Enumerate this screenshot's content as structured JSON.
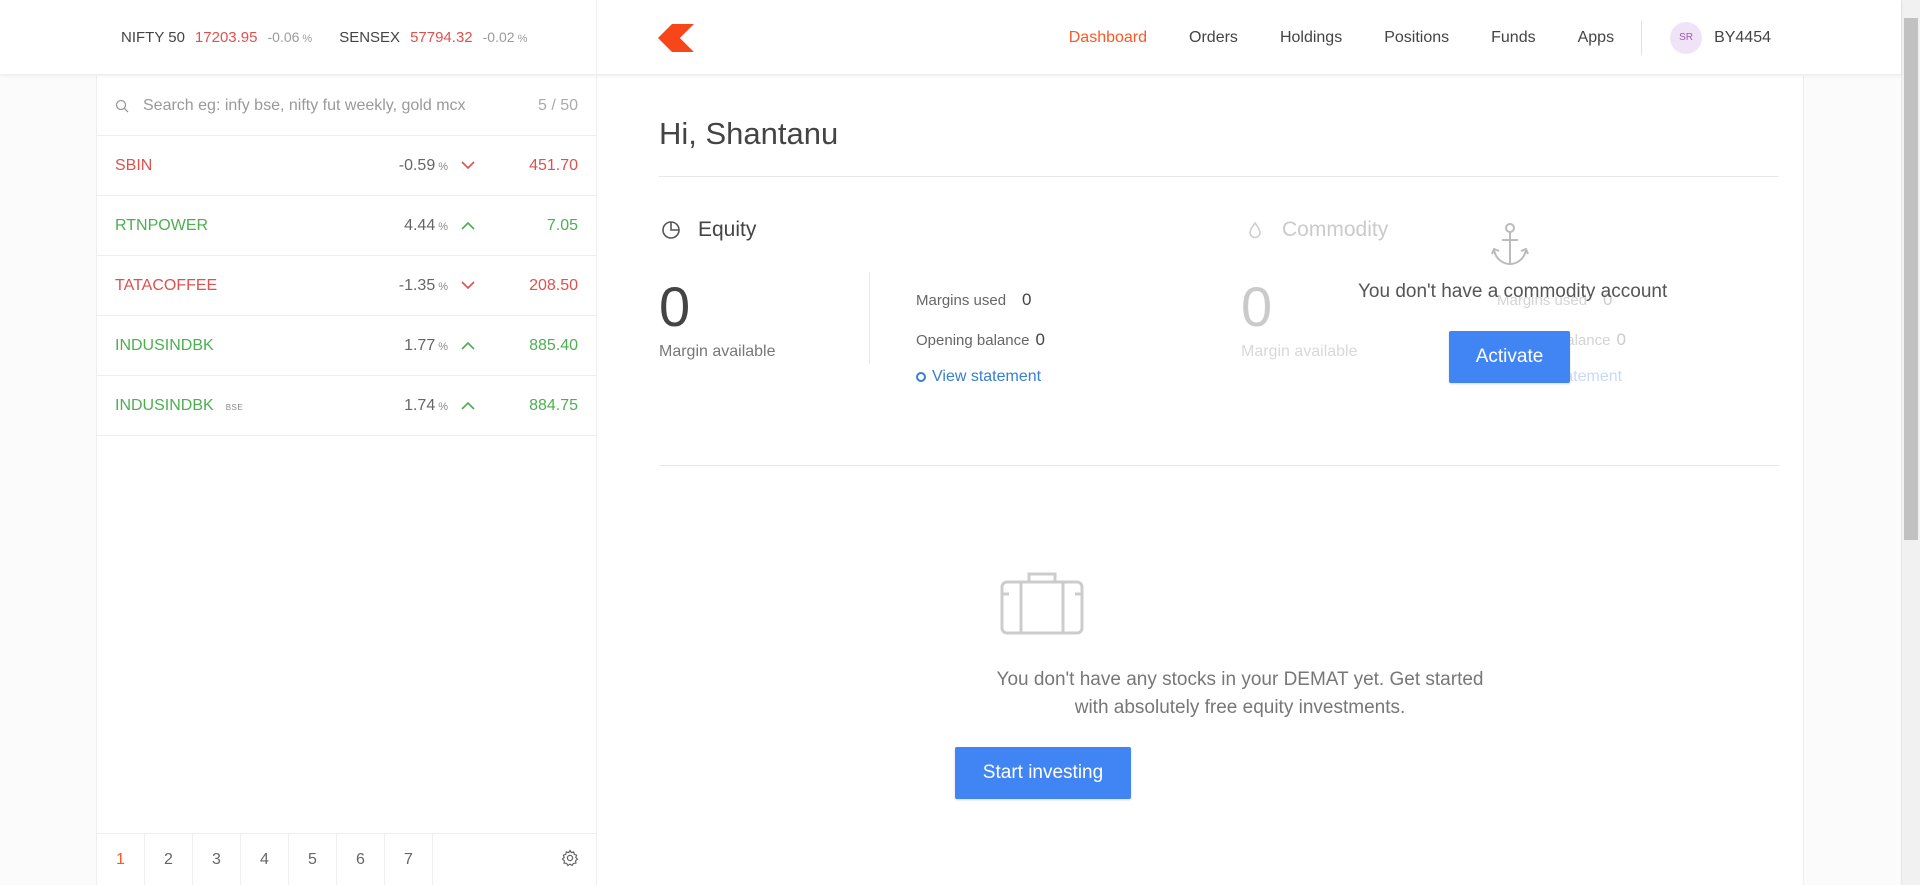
{
  "indices": [
    {
      "name": "NIFTY 50",
      "value": "17203.95",
      "change": "-0.06",
      "pct": "%"
    },
    {
      "name": "SENSEX",
      "value": "57794.32",
      "change": "-0.02",
      "pct": "%"
    }
  ],
  "nav": {
    "items": [
      "Dashboard",
      "Orders",
      "Holdings",
      "Positions",
      "Funds",
      "Apps"
    ],
    "active": "Dashboard",
    "avatar_initials": "SR",
    "user_id": "BY4454"
  },
  "search": {
    "placeholder": "Search eg: infy bse, nifty fut weekly, gold mcx",
    "count": "5 / 50"
  },
  "watchlist": [
    {
      "symbol": "SBIN",
      "exchange": "",
      "change": "-0.59",
      "pct": "%",
      "price": "451.70",
      "direction": "down"
    },
    {
      "symbol": "RTNPOWER",
      "exchange": "",
      "change": "4.44",
      "pct": "%",
      "price": "7.05",
      "direction": "up"
    },
    {
      "symbol": "TATACOFFEE",
      "exchange": "",
      "change": "-1.35",
      "pct": "%",
      "price": "208.50",
      "direction": "down"
    },
    {
      "symbol": "INDUSINDBK",
      "exchange": "",
      "change": "1.77",
      "pct": "%",
      "price": "885.40",
      "direction": "up"
    },
    {
      "symbol": "INDUSINDBK",
      "exchange": "BSE",
      "change": "1.74",
      "pct": "%",
      "price": "884.75",
      "direction": "up"
    }
  ],
  "pages": [
    "1",
    "2",
    "3",
    "4",
    "5",
    "6",
    "7"
  ],
  "active_page": "1",
  "greeting": "Hi, Shantanu",
  "equity": {
    "title": "Equity",
    "margin_available": "0",
    "margin_available_label": "Margin available",
    "margins_used_label": "Margins used",
    "margins_used": "0",
    "opening_balance_label": "Opening balance",
    "opening_balance": "0",
    "view_statement": "View statement"
  },
  "commodity": {
    "title": "Commodity",
    "margin_available": "0",
    "margin_available_label": "Margin available",
    "margins_used_label": "Margins used",
    "margins_used": "0",
    "opening_balance_label": "Opening balance",
    "opening_balance": "0",
    "view_statement": "View statement",
    "no_account_text": "You don't have a commodity account",
    "activate_label": "Activate"
  },
  "holdings_empty": {
    "line1": "You don't have any stocks in your DEMAT yet. Get started",
    "line2": "with absolutely free equity investments.",
    "button_label": "Start investing"
  },
  "colors": {
    "accent": "#ff5722",
    "down": "#df514c",
    "up": "#4caf50",
    "button": "#4184f3",
    "link": "#387ed1"
  }
}
